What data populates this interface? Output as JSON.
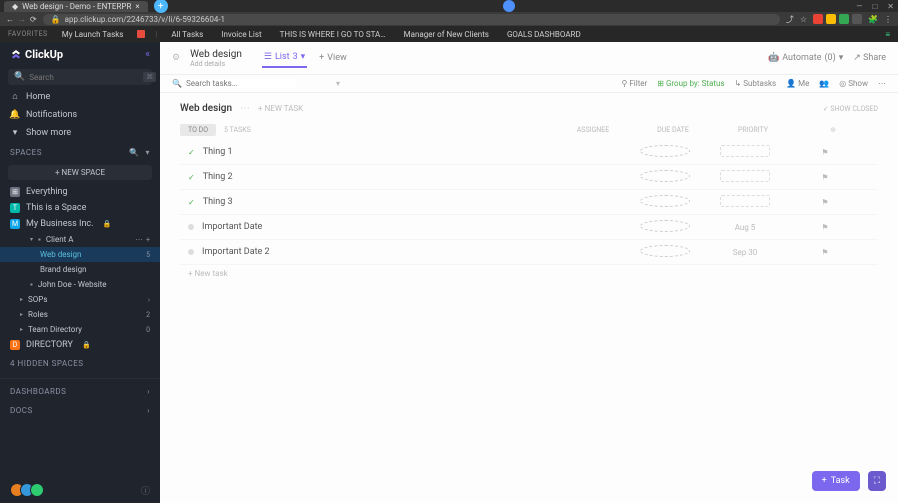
{
  "browser": {
    "tab_title": "Web design - Demo - ENTERPR",
    "url": "app.clickup.com/2246733/v/li/6-59326604-1",
    "win": {
      "min": "—",
      "max": "□",
      "close": "✕"
    }
  },
  "favbar": {
    "label": "FAVORITES",
    "items": [
      "My Launch Tasks"
    ],
    "links": [
      "All Tasks",
      "Invoice List",
      "THIS IS WHERE I GO TO STA…",
      "Manager of New Clients",
      "GOALS DASHBOARD"
    ]
  },
  "sidebar": {
    "brand": "ClickUp",
    "search_placeholder": "Search",
    "nav": [
      {
        "icon": "home",
        "label": "Home"
      },
      {
        "icon": "bell",
        "label": "Notifications"
      },
      {
        "icon": "more",
        "label": "Show more"
      }
    ],
    "spaces_label": "SPACES",
    "new_space": "+  NEW SPACE",
    "spaces": [
      {
        "color": "#6b7280",
        "initial": "⊞",
        "label": "Everything"
      },
      {
        "color": "#00b8a9",
        "initial": "T",
        "label": "This is a Space"
      },
      {
        "color": "#0ea5e9",
        "initial": "M",
        "label": "My Business Inc.",
        "lock": true
      }
    ],
    "tree": [
      {
        "level": 2,
        "type": "folder",
        "label": "Client A",
        "actions": true
      },
      {
        "level": 3,
        "type": "list",
        "label": "Web design",
        "badge": "5",
        "active": true
      },
      {
        "level": 3,
        "type": "list",
        "label": "Brand design"
      },
      {
        "level": 2,
        "type": "folder",
        "label": "John Doe - Website"
      },
      {
        "level": 1,
        "type": "list",
        "label": "SOPs",
        "badge": ">"
      },
      {
        "level": 1,
        "type": "list",
        "label": "Roles",
        "badge": "2"
      },
      {
        "level": 1,
        "type": "list",
        "label": "Team Directory",
        "badge": "0"
      }
    ],
    "directory": {
      "color": "#f97316",
      "initial": "D",
      "label": "DIRECTORY",
      "lock": true
    },
    "hidden": "4 HIDDEN SPACES",
    "dashboards": "DASHBOARDS",
    "docs": "DOCS"
  },
  "main": {
    "title": "Web design",
    "subtitle": "Add details",
    "tabs": [
      {
        "icon": "list",
        "label": "List",
        "badge": "3",
        "active": true
      },
      {
        "icon": "plus",
        "label": "View"
      }
    ],
    "automate": "Automate",
    "automate_count": "(0)",
    "share": "Share",
    "toolbar": {
      "search_placeholder": "Search tasks…",
      "filter": "Filter",
      "group": "Group by: Status",
      "subtasks": "Subtasks",
      "me": "Me",
      "show": "Show"
    },
    "list": {
      "title": "Web design",
      "new_task_hint": "+ NEW TASK",
      "show_closed": "✓ SHOW CLOSED",
      "status": "TO DO",
      "task_count": "5 TASKS",
      "columns": [
        "ASSIGNEE",
        "DUE DATE",
        "PRIORITY"
      ],
      "tasks": [
        {
          "done": true,
          "name": "Thing 1",
          "due": ""
        },
        {
          "done": true,
          "name": "Thing 2",
          "due": ""
        },
        {
          "done": true,
          "name": "Thing 3",
          "due": ""
        },
        {
          "done": false,
          "name": "Important Date",
          "due": "Aug 5"
        },
        {
          "done": false,
          "name": "Important Date 2",
          "due": "Sep 30"
        }
      ],
      "new_task": "+ New task"
    },
    "task_button": "Task"
  }
}
